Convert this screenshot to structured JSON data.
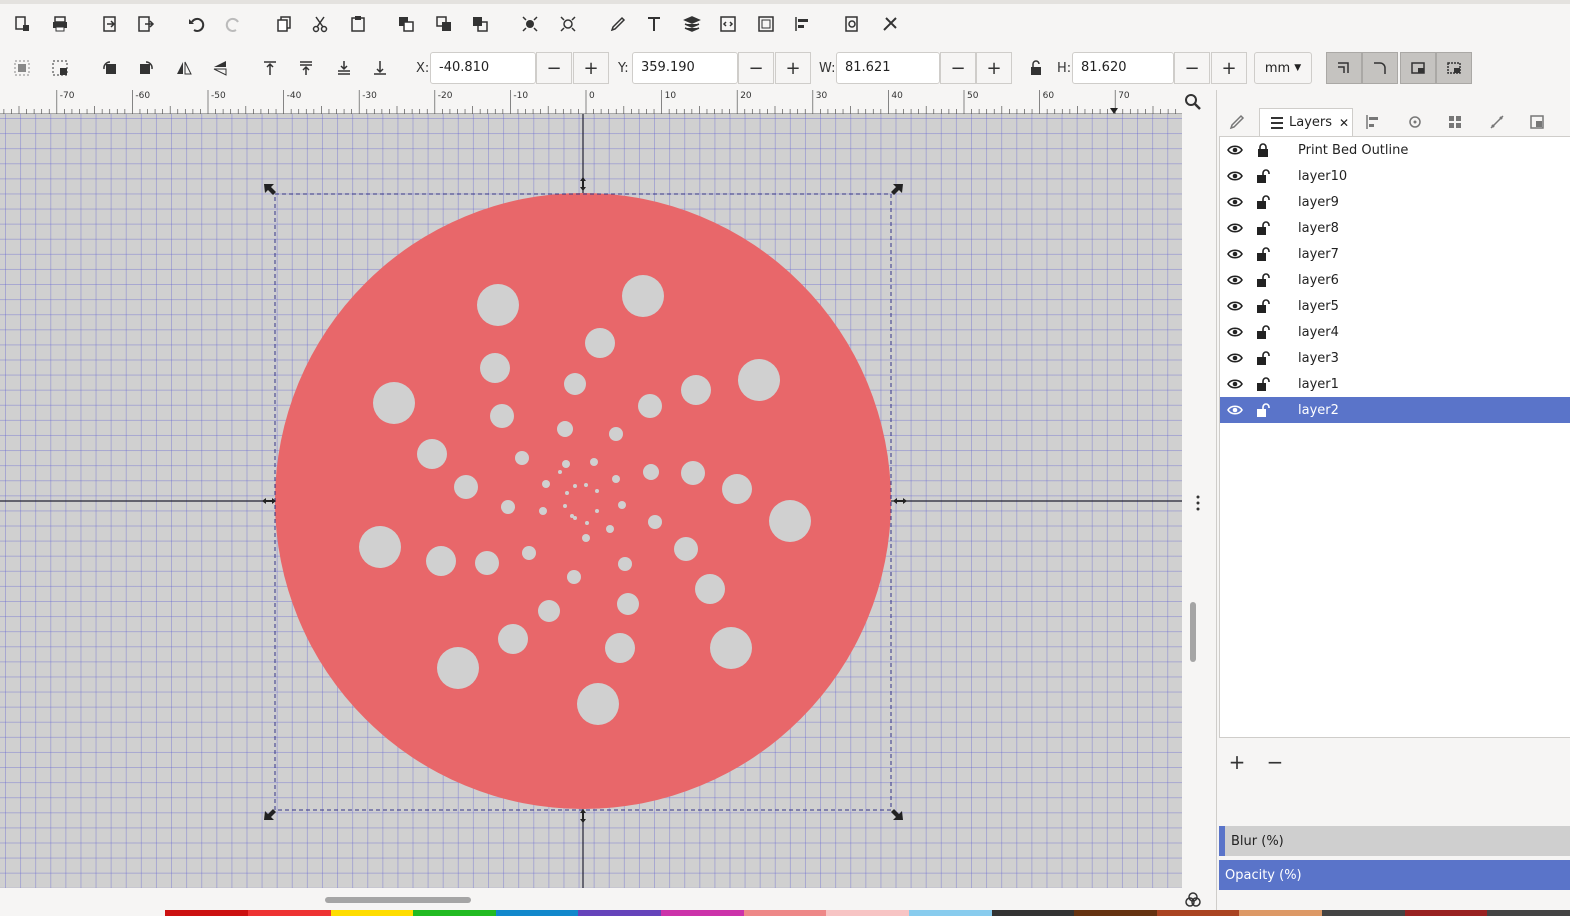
{
  "toolbar": {
    "coords": {
      "x_label": "X:",
      "x_value": "-40.810",
      "y_label": "Y:",
      "y_value": "359.190",
      "w_label": "W:",
      "w_value": "81.621",
      "h_label": "H:",
      "h_value": "81.620",
      "minus": "−",
      "plus": "+"
    },
    "unit": "mm"
  },
  "ruler": {
    "labels": [
      "-70",
      "-60",
      "-50",
      "-40",
      "-30",
      "-20",
      "-10",
      "0",
      "10",
      "20",
      "30",
      "40",
      "50",
      "60",
      "70"
    ]
  },
  "dock": {
    "active_tab": "Layers",
    "layers": [
      {
        "name": "Print Bed Outline",
        "locked": true,
        "visible": true,
        "selected": false
      },
      {
        "name": "layer10",
        "locked": false,
        "visible": true,
        "selected": false
      },
      {
        "name": "layer9",
        "locked": false,
        "visible": true,
        "selected": false
      },
      {
        "name": "layer8",
        "locked": false,
        "visible": true,
        "selected": false
      },
      {
        "name": "layer7",
        "locked": false,
        "visible": true,
        "selected": false
      },
      {
        "name": "layer6",
        "locked": false,
        "visible": true,
        "selected": false
      },
      {
        "name": "layer5",
        "locked": false,
        "visible": true,
        "selected": false
      },
      {
        "name": "layer4",
        "locked": false,
        "visible": true,
        "selected": false
      },
      {
        "name": "layer3",
        "locked": false,
        "visible": true,
        "selected": false
      },
      {
        "name": "layer1",
        "locked": false,
        "visible": true,
        "selected": false
      },
      {
        "name": "layer2",
        "locked": false,
        "visible": true,
        "selected": true
      }
    ],
    "add_label": "+",
    "remove_label": "−",
    "blur_label": "Blur (%)",
    "opacity_label": "Opacity (%)"
  },
  "colors": {
    "disc": "#e8676a",
    "hole": "#d0d0d0",
    "selection": "#5a74c9"
  }
}
